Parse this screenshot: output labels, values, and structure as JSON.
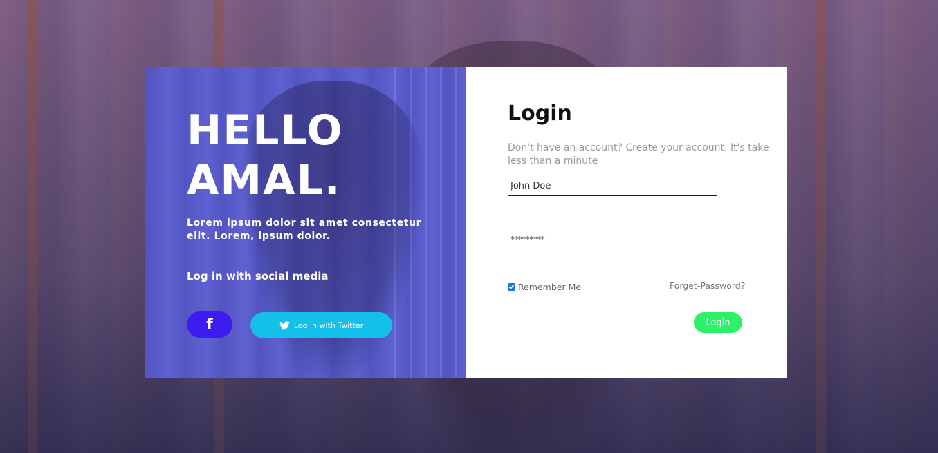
{
  "hero": {
    "line1": "HELLO",
    "line2": "AMAL.",
    "description": "Lorem ipsum dolor sit amet consectetur elit. Lorem, ipsum dolor.",
    "social_title": "Log in with social media",
    "facebook_icon": "f",
    "twitter_label": "Log in with Twitter"
  },
  "form": {
    "title": "Login",
    "subtitle": "Don't have an account? Create your account. It's take less than a minute",
    "name_value": "John Doe",
    "password_value": "*********",
    "remember_label": "Remember Me",
    "remember_checked": true,
    "forget_label": "Forget-Password?",
    "login_label": "Login"
  },
  "colors": {
    "facebook": "#3d1cf0",
    "twitter": "#14bfea",
    "login_button": "#2ef06a",
    "hero_overlay": "#585cdc"
  },
  "icons": {
    "facebook": "facebook-icon",
    "twitter": "twitter-icon"
  }
}
